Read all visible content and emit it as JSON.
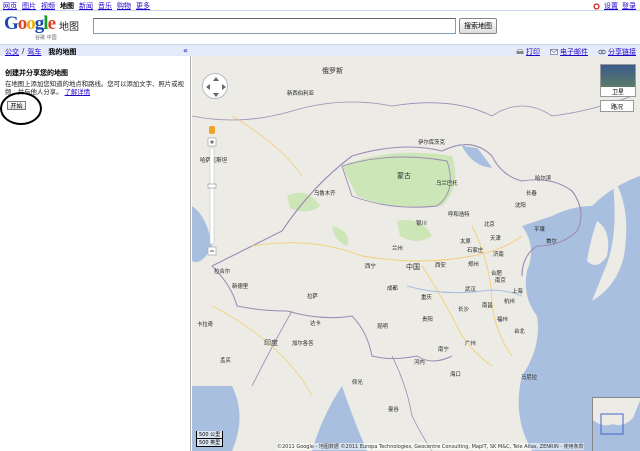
{
  "topnav": {
    "items": [
      "网页",
      "图片",
      "视频",
      "地图",
      "新闻",
      "音乐",
      "购物",
      "更多"
    ],
    "active_index": 3,
    "right_links": [
      "设置",
      "登录"
    ]
  },
  "header": {
    "logo_text": "Google",
    "logo_sub": "地图",
    "logo_cn": "谷歌 中国",
    "search_value": "",
    "search_button": "搜索地图"
  },
  "toolbar": {
    "tabs": [
      "公交",
      "驾车",
      "我的地图"
    ],
    "active_tab": "我的地图",
    "separator": "/",
    "collapse_symbol": "«",
    "actions": [
      "打印",
      "电子邮件",
      "分享链接"
    ]
  },
  "panel": {
    "title": "创建并分享您的地图",
    "description": "在地图上添加您知道的地点和路线。您可以添加文字、照片或视频，并与他人分享。",
    "learn_more": "了解详情",
    "start_button": "开始"
  },
  "map": {
    "labels": {
      "russia": "俄罗斯",
      "mongolia": "蒙古",
      "china": "中国",
      "india": "印度",
      "kazakhstan": "哈萨克斯坦",
      "novosibirsk": "新西伯利亚",
      "urumqi": "乌鲁木齐",
      "lhasa": "拉萨",
      "xining": "西宁",
      "lanzhou": "兰州",
      "xian": "西安",
      "chengdu": "成都",
      "chongqing": "重庆",
      "wuhan": "武汉",
      "nanjing": "南京",
      "shanghai": "上海",
      "beijing": "北京",
      "tianjin": "天津",
      "shenyang": "沈阳",
      "changchun": "长春",
      "harbin": "哈尔滨",
      "hohhot": "呼和浩特",
      "kunming": "昆明",
      "nanning": "南宁",
      "guangzhou": "广州",
      "fuzhou": "福州",
      "hangzhou": "杭州",
      "taipei": "台北",
      "hanoi": "河内",
      "bangkok": "曼谷",
      "delhi": "新德里",
      "kolkata": "加尔各答",
      "mumbai": "孟买",
      "seoul": "首尔",
      "pyongyang": "平壤",
      "manila": "马尼拉",
      "ulaanbaatar": "乌兰巴托",
      "irkutsk": "伊尔库茨克",
      "dhaka": "达卡",
      "karachi": "卡拉奇",
      "lahore": "拉合尔",
      "yangon": "仰光",
      "taiyuan": "太原",
      "shijiazhuang": "石家庄",
      "jinan": "济南",
      "zhengzhou": "郑州",
      "changsha": "长沙",
      "guiyang": "贵阳",
      "hefei": "合肥",
      "nanchang": "南昌",
      "yinchuan": "银川",
      "haikou": "海口"
    },
    "type_satellite": "卫星",
    "type_terrain": "路况",
    "scale_top": "500 公里",
    "scale_bottom": "500 英里",
    "copyright": "©2011 Google - 地图数据 ©2011 Europa Technologies, Geocentre Consulting, MapIT, SK M&C, Tele Atlas, ZENRIN - 使用条款"
  }
}
